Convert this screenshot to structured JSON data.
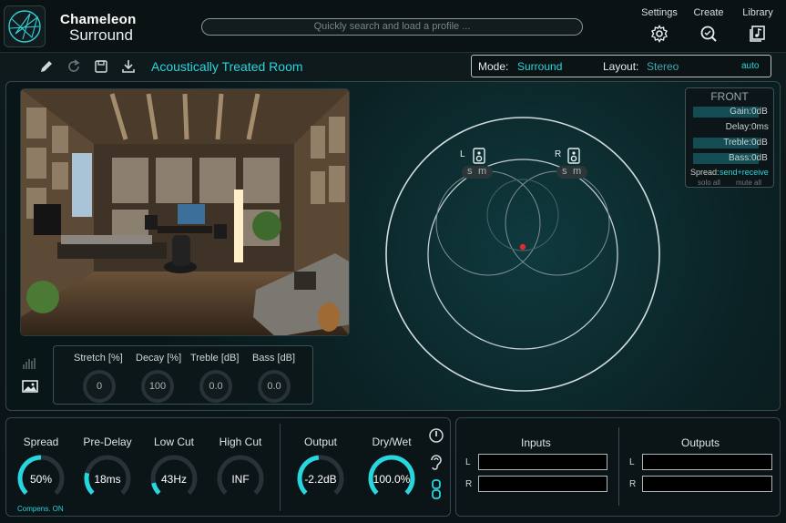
{
  "header": {
    "brand_line1": "Chameleon",
    "brand_line2": "Surround",
    "search_placeholder": "Quickly search and load a profile ...",
    "buttons": [
      {
        "label": "Settings",
        "icon": "gear-icon"
      },
      {
        "label": "Create",
        "icon": "wand-search-icon"
      },
      {
        "label": "Library",
        "icon": "library-icon"
      }
    ]
  },
  "toolbar": {
    "icons": [
      "pencil-icon",
      "refresh-icon",
      "save-icon",
      "download-icon"
    ],
    "profile_name": "Acoustically Treated Room",
    "mode_label": "Mode:",
    "mode_value": "Surround",
    "layout_label": "Layout:",
    "layout_value": "Stereo",
    "auto_label": "auto"
  },
  "room_params": {
    "locked": true,
    "params": [
      {
        "label": "Stretch [%]",
        "value": "0"
      },
      {
        "label": "Decay [%]",
        "value": "100"
      },
      {
        "label": "Treble [dB]",
        "value": "0.0"
      },
      {
        "label": "Bass [dB]",
        "value": "0.0"
      }
    ]
  },
  "front_panel": {
    "title": "FRONT",
    "rows": [
      {
        "label": "Gain:",
        "value": "0dB"
      },
      {
        "label": "Delay:",
        "value": "0ms"
      },
      {
        "label": "Treble:",
        "value": "0dB"
      },
      {
        "label": "Bass:",
        "value": "0dB"
      }
    ],
    "spread_label": "Spread:",
    "spread_value": "send+receive",
    "solo_all": "solo all",
    "mute_all": "mute all"
  },
  "speakers": [
    {
      "label": "L",
      "s": "s",
      "m": "m"
    },
    {
      "label": "R",
      "s": "s",
      "m": "m"
    }
  ],
  "controls": {
    "knobs": [
      {
        "label": "Spread",
        "value": "50%",
        "level": 0.5
      },
      {
        "label": "Pre-Delay",
        "value": "18ms",
        "level": 0.22
      },
      {
        "label": "Low Cut",
        "value": "43Hz",
        "level": 0.12
      },
      {
        "label": "High Cut",
        "value": "INF",
        "level": 0.0
      },
      {
        "label": "Output",
        "value": "-2.2dB",
        "level": 0.48
      },
      {
        "label": "Dry/Wet",
        "value": "100.0%",
        "level": 1.0
      }
    ],
    "compens": "Compens. ON"
  },
  "io": {
    "inputs_title": "Inputs",
    "outputs_title": "Outputs",
    "l": "L",
    "r": "R"
  },
  "colors": {
    "accent": "#27d6de",
    "knob_track": "#273336",
    "panel_border": "#34494d"
  }
}
